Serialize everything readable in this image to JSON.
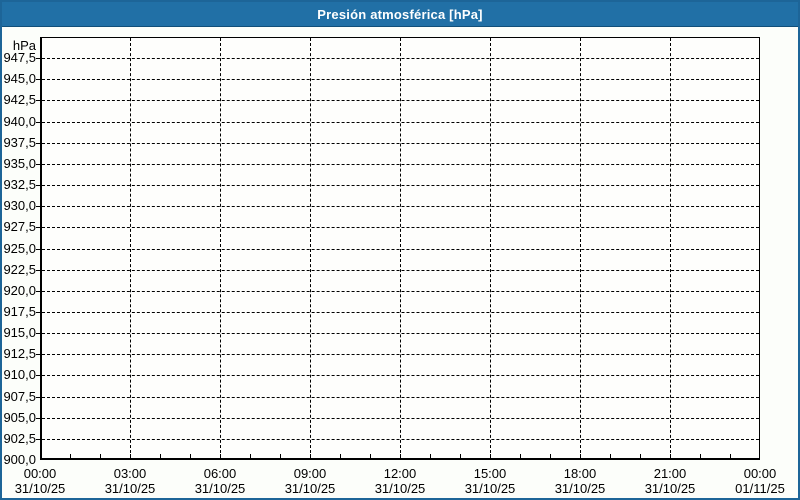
{
  "window": {
    "title": "Presión atmosférica [hPa]"
  },
  "colors": {
    "titlebar_bg": "#2170a6",
    "titlebar_text": "#ffffff",
    "window_border": "#1d6598",
    "window_bg": "#fcfefa",
    "plot_bg": "#fefefc",
    "axis": "#000000",
    "grid": "#000000",
    "label_text": "#000000"
  },
  "chart_data": {
    "type": "line",
    "title": "Presión atmosférica [hPa]",
    "xlabel": "",
    "ylabel": "hPa",
    "ylim": [
      900,
      950
    ],
    "y_step": 2.5,
    "grid": "dashed",
    "legend": "none",
    "series": [],
    "y_tick_labels": [
      "947,5",
      "945,0",
      "942,5",
      "940,0",
      "937,5",
      "935,0",
      "932,5",
      "930,0",
      "927,5",
      "925,0",
      "922,5",
      "920,0",
      "917,5",
      "915,0",
      "912,5",
      "910,0",
      "907,5",
      "905,0",
      "902,5",
      "900,0"
    ],
    "x_axis": {
      "total_hours": 24,
      "hours_per_label": 3,
      "minor_tick_hours": 1,
      "labels": [
        {
          "time": "00:00",
          "date": "31/10/25"
        },
        {
          "time": "03:00",
          "date": "31/10/25"
        },
        {
          "time": "06:00",
          "date": "31/10/25"
        },
        {
          "time": "09:00",
          "date": "31/10/25"
        },
        {
          "time": "12:00",
          "date": "31/10/25"
        },
        {
          "time": "15:00",
          "date": "31/10/25"
        },
        {
          "time": "18:00",
          "date": "31/10/25"
        },
        {
          "time": "21:00",
          "date": "31/10/25"
        },
        {
          "time": "00:00",
          "date": "01/11/25"
        }
      ]
    }
  }
}
